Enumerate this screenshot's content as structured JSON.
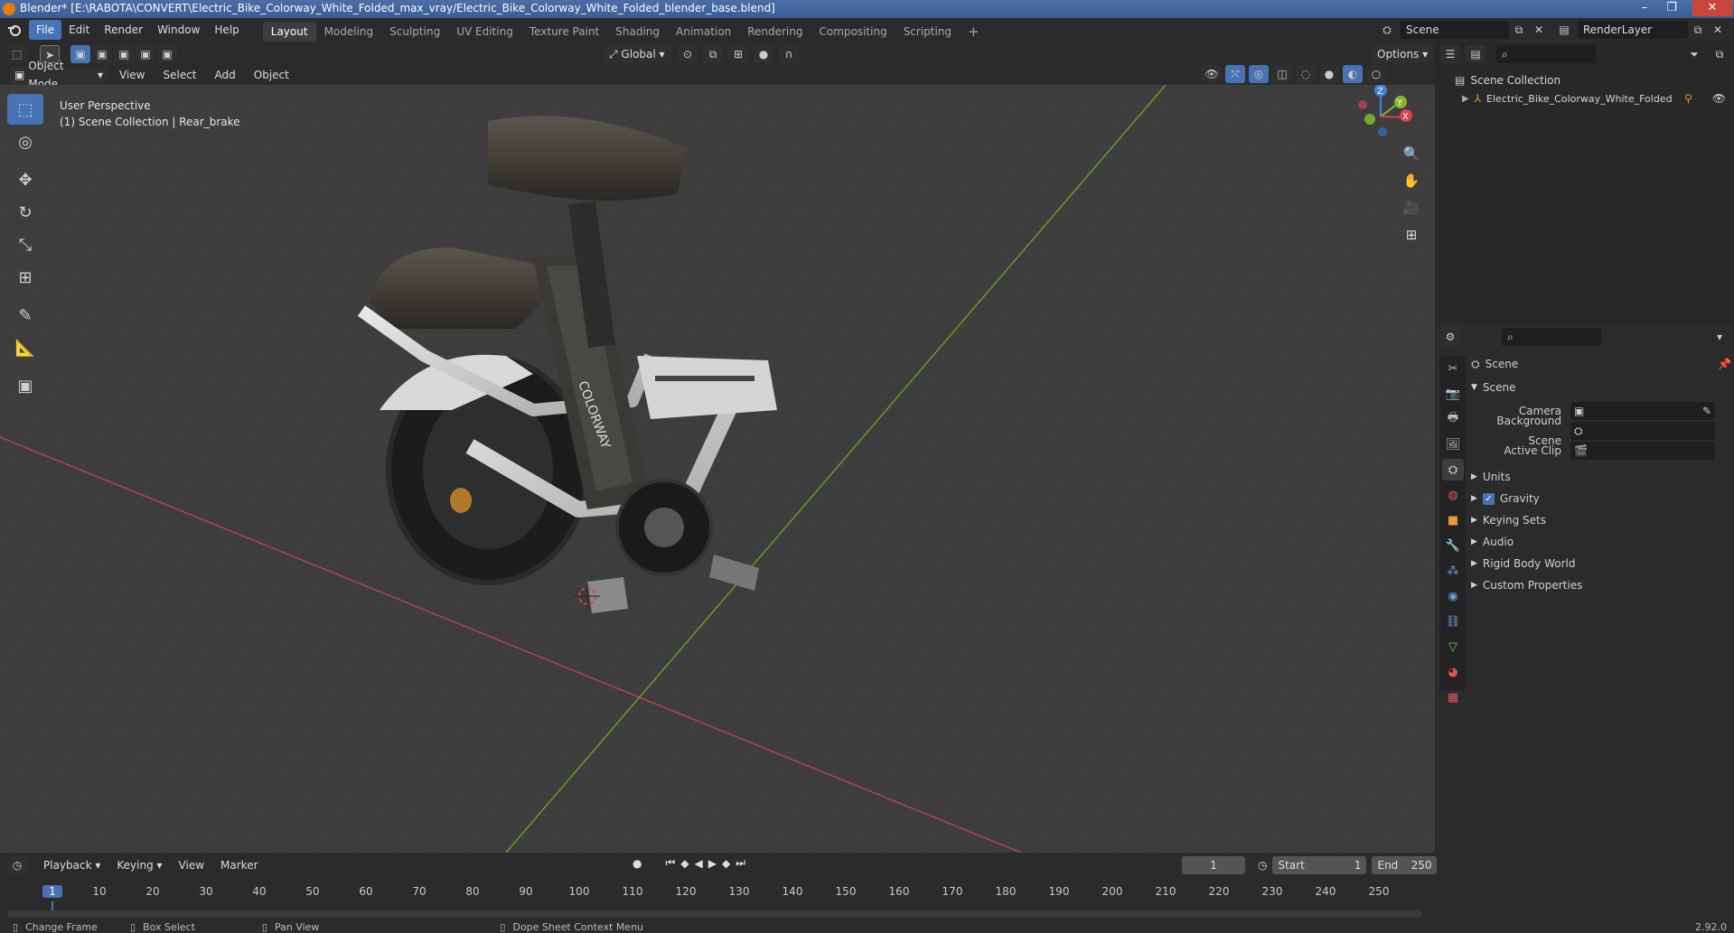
{
  "window": {
    "title": "Blender* [E:\\RABOTA\\CONVERT\\Electric_Bike_Colorway_White_Folded_max_vray/Electric_Bike_Colorway_White_Folded_blender_base.blend]",
    "minimize": "–",
    "maximize": "❐",
    "close": "✕"
  },
  "menu": {
    "items": [
      "File",
      "Edit",
      "Render",
      "Window",
      "Help"
    ],
    "workspaces": [
      "Layout",
      "Modeling",
      "Sculpting",
      "UV Editing",
      "Texture Paint",
      "Shading",
      "Animation",
      "Rendering",
      "Compositing",
      "Scripting"
    ],
    "add_workspace": "+",
    "scene_field": "Scene",
    "renderlayer_field": "RenderLayer"
  },
  "viewport_header": {
    "mode": "Object Mode",
    "menus": [
      "View",
      "Select",
      "Add",
      "Object"
    ],
    "transform_orientation": "Global",
    "options_label": "Options"
  },
  "viewport": {
    "perspective": "User Perspective",
    "collection_info": "(1) Scene Collection | Rear_brake",
    "gizmo_axes": [
      "Z",
      "Y",
      "X"
    ],
    "brand_text": "COLORWAY"
  },
  "outliner": {
    "root": "Scene Collection",
    "items": [
      {
        "label": "Electric_Bike_Colorway_White_Folded"
      }
    ]
  },
  "properties": {
    "breadcrumb": "Scene",
    "panel_title": "Scene",
    "fields": [
      {
        "label": "Camera"
      },
      {
        "label": "Background Scene"
      },
      {
        "label": "Active Clip"
      }
    ],
    "subpanels": [
      {
        "label": "Units",
        "checkbox": false
      },
      {
        "label": "Gravity",
        "checkbox": true,
        "checked": true
      },
      {
        "label": "Keying Sets",
        "checkbox": false
      },
      {
        "label": "Audio",
        "checkbox": false
      },
      {
        "label": "Rigid Body World",
        "checkbox": false
      },
      {
        "label": "Custom Properties",
        "checkbox": false
      }
    ]
  },
  "timeline": {
    "menus": [
      "Playback",
      "Keying",
      "View",
      "Marker"
    ],
    "current_frame": "1",
    "start_label": "Start",
    "start": "1",
    "end_label": "End",
    "end": "250",
    "ticks": [
      "1",
      "10",
      "20",
      "30",
      "40",
      "50",
      "60",
      "70",
      "80",
      "90",
      "100",
      "110",
      "120",
      "130",
      "140",
      "150",
      "160",
      "170",
      "180",
      "190",
      "200",
      "210",
      "220",
      "230",
      "240",
      "250"
    ]
  },
  "statusbar": {
    "items": [
      "Change Frame",
      "Box Select",
      "Pan View",
      "Dope Sheet Context Menu"
    ],
    "version": "2.92.0"
  },
  "colors": {
    "accent": "#4772b3",
    "x_axis": "#d9424f",
    "y_axis": "#8ab52f",
    "z_axis": "#3f82d6"
  }
}
